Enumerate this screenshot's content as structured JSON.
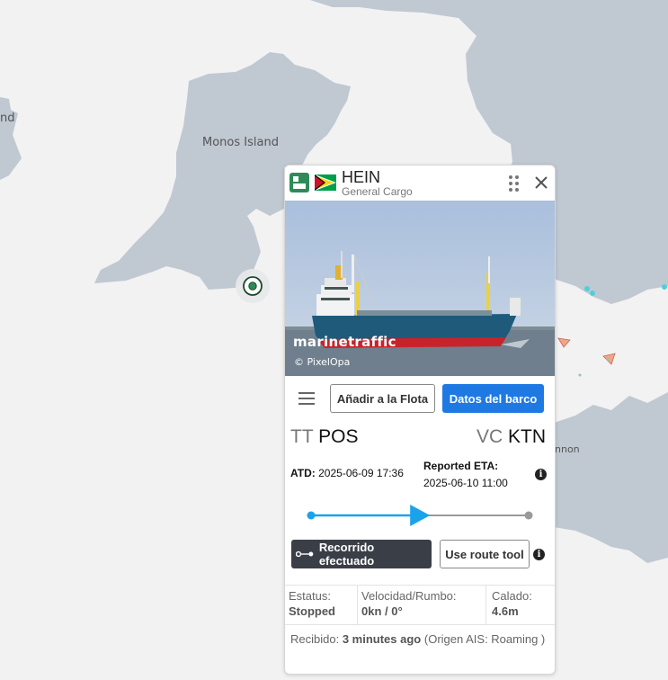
{
  "map": {
    "labels": [
      "Monos Island",
      "nd",
      "nnon"
    ],
    "colors": {
      "sea": "#f2f2f2",
      "land": "#c0c8d2"
    }
  },
  "vessel": {
    "name": "HEIN",
    "type": "General Cargo",
    "flag_icon": "guyana-flag-icon",
    "photo": {
      "watermark": "marinetraffic",
      "credit": "© PixelOpa"
    }
  },
  "actions": {
    "add_fleet": "Añadir a la Flota",
    "vessel_data": "Datos del barco",
    "track": "Recorrido efectuado",
    "route_tool": "Use route tool"
  },
  "voyage": {
    "origin": {
      "country": "TT",
      "port": "POS"
    },
    "destination": {
      "country": "VC",
      "port": "KTN"
    },
    "atd_label": "ATD:",
    "atd_value": "2025-06-09 17:36",
    "eta_label": "Reported ETA:",
    "eta_value": "2025-06-10 11:00",
    "progress": 0.53
  },
  "stats": {
    "status_label": "Estatus:",
    "status_value": "Stopped",
    "speed_label": "Velocidad/Rumbo:",
    "speed_value": "0kn / 0°",
    "draught_label": "Calado:",
    "draught_value": "4.6m"
  },
  "received": {
    "prefix": "Recibido:",
    "time": "3 minutes ago",
    "source": "(Origen AIS: Roaming )"
  },
  "colors": {
    "primary": "#1e79e3",
    "dark_button": "#3a3f47",
    "route": "#1aa3ea",
    "brand": "#2e8b57"
  }
}
